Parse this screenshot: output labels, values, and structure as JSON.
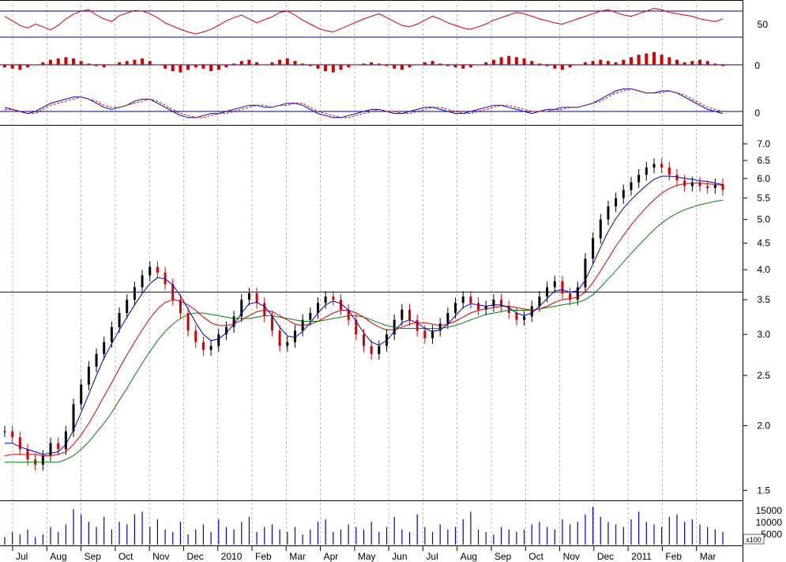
{
  "chart_data": [
    {
      "type": "line",
      "indicator_panel": "RSI",
      "y_ticks": [
        "50"
      ],
      "levels": [
        70,
        30
      ],
      "series": [
        {
          "color": "#d40000",
          "values": [
            62,
            55,
            48,
            44,
            50,
            46,
            41,
            48,
            58,
            65,
            70,
            72,
            64,
            58,
            54,
            63,
            67,
            71,
            70,
            66,
            60,
            52,
            47,
            42,
            38,
            35,
            38,
            42,
            48,
            55,
            60,
            64,
            58,
            52,
            57,
            61,
            68,
            70,
            64,
            56,
            50,
            44,
            40,
            38,
            43,
            48,
            53,
            58,
            62,
            66,
            60,
            54,
            48,
            46,
            50,
            56,
            62,
            58,
            52,
            48,
            44,
            42,
            46,
            50,
            56,
            60,
            64,
            68,
            66,
            62,
            58,
            55,
            52,
            50,
            54,
            58,
            62,
            66,
            70,
            72,
            68,
            64,
            62,
            66,
            70,
            74,
            72,
            68,
            66,
            64,
            62,
            58,
            56,
            54,
            58
          ]
        }
      ]
    },
    {
      "type": "bar",
      "indicator_panel": "MACD histogram",
      "y_ticks": [
        "0"
      ],
      "series": [
        {
          "color": "#d40000",
          "values": [
            -2,
            -3,
            -4,
            -2,
            0,
            2,
            4,
            5,
            6,
            5,
            3,
            1,
            -1,
            -2,
            0,
            2,
            3,
            4,
            5,
            3,
            0,
            -3,
            -5,
            -6,
            -4,
            -2,
            -3,
            -5,
            -4,
            -2,
            1,
            3,
            4,
            2,
            0,
            2,
            4,
            5,
            3,
            1,
            -1,
            -3,
            -5,
            -6,
            -4,
            -2,
            0,
            1,
            2,
            1,
            -1,
            -3,
            -4,
            -2,
            0,
            2,
            3,
            1,
            -1,
            -2,
            -3,
            -2,
            0,
            2,
            4,
            6,
            7,
            6,
            5,
            3,
            1,
            -1,
            -3,
            -4,
            -2,
            0,
            2,
            3,
            4,
            3,
            2,
            4,
            6,
            8,
            9,
            10,
            8,
            6,
            4,
            2,
            3,
            4,
            3,
            1,
            -1
          ]
        }
      ]
    },
    {
      "type": "line",
      "indicator_panel": "MACD",
      "y_ticks": [
        "0"
      ],
      "series": [
        {
          "color": "#0000cc",
          "values": [
            2,
            1,
            0,
            -1,
            0,
            2,
            4,
            5,
            6,
            7,
            7,
            6,
            4,
            2,
            1,
            2,
            3,
            5,
            6,
            6,
            4,
            2,
            0,
            -2,
            -3,
            -3,
            -2,
            -1,
            -1,
            0,
            1,
            2,
            3,
            3,
            2,
            2,
            3,
            4,
            4,
            3,
            1,
            -1,
            -2,
            -3,
            -3,
            -2,
            -1,
            0,
            1,
            1,
            0,
            -1,
            -1,
            0,
            1,
            2,
            2,
            1,
            0,
            -1,
            -1,
            0,
            1,
            2,
            3,
            3,
            2,
            1,
            0,
            -1,
            0,
            1,
            1,
            2,
            2,
            2,
            3,
            4,
            6,
            8,
            10,
            11,
            11,
            10,
            9,
            9,
            10,
            10,
            9,
            7,
            5,
            3,
            1,
            0,
            -1
          ]
        },
        {
          "color": "#d40000",
          "values": [
            1,
            1,
            0,
            -1,
            -1,
            1,
            3,
            4,
            5,
            6,
            7,
            6,
            5,
            3,
            2,
            2,
            3,
            4,
            5,
            6,
            5,
            3,
            1,
            -1,
            -2,
            -3,
            -3,
            -2,
            -1,
            -1,
            0,
            1,
            2,
            3,
            3,
            2,
            3,
            3,
            4,
            4,
            2,
            0,
            -1,
            -2,
            -3,
            -3,
            -2,
            -1,
            0,
            1,
            0,
            0,
            -1,
            -1,
            0,
            1,
            2,
            2,
            1,
            0,
            -1,
            -1,
            0,
            1,
            2,
            3,
            3,
            2,
            1,
            0,
            0,
            0,
            1,
            1,
            2,
            2,
            3,
            4,
            5,
            7,
            9,
            10,
            11,
            10,
            9,
            9,
            9,
            10,
            9,
            8,
            6,
            4,
            2,
            1,
            0
          ]
        }
      ]
    },
    {
      "type": "candlestick",
      "scale": "log",
      "ylim": [
        1.45,
        7.3
      ],
      "y_ticks": [
        "7.0",
        "6.5",
        "6.0",
        "5.5",
        "5.0",
        "4.5",
        "4.0",
        "3.5",
        "3.0",
        "2.5",
        "2.0",
        "1.5"
      ],
      "months": [
        "Jul",
        "Aug",
        "Sep",
        "Oct",
        "Nov",
        "Dec",
        "2010",
        "Feb",
        "Mar",
        "Apr",
        "May",
        "Jun",
        "Jul",
        "Aug",
        "Sep",
        "Oct",
        "Nov",
        "Dec",
        "2011",
        "Feb",
        "Mar"
      ],
      "horizontal_line": 3.62,
      "close": [
        1.95,
        1.9,
        1.8,
        1.72,
        1.68,
        1.75,
        1.85,
        1.8,
        1.95,
        2.2,
        2.4,
        2.6,
        2.75,
        2.9,
        3.1,
        3.3,
        3.5,
        3.7,
        3.9,
        4.05,
        3.95,
        3.75,
        3.5,
        3.3,
        3.05,
        2.9,
        2.8,
        2.85,
        3.0,
        3.1,
        3.25,
        3.5,
        3.6,
        3.45,
        3.25,
        3.05,
        2.85,
        2.9,
        3.05,
        3.2,
        3.3,
        3.45,
        3.55,
        3.5,
        3.35,
        3.2,
        3.0,
        2.85,
        2.75,
        2.85,
        3.0,
        3.2,
        3.35,
        3.2,
        3.05,
        2.95,
        3.05,
        3.15,
        3.3,
        3.45,
        3.55,
        3.45,
        3.35,
        3.4,
        3.5,
        3.4,
        3.3,
        3.2,
        3.25,
        3.4,
        3.55,
        3.7,
        3.8,
        3.6,
        3.5,
        3.7,
        4.2,
        4.6,
        5.0,
        5.3,
        5.5,
        5.7,
        5.9,
        6.1,
        6.3,
        6.4,
        6.3,
        6.1,
        5.95,
        5.8,
        5.9,
        5.8,
        5.75,
        5.85,
        5.7
      ],
      "ma_fast": [
        1.85,
        1.85,
        1.82,
        1.8,
        1.78,
        1.76,
        1.77,
        1.78,
        1.84,
        1.96,
        2.12,
        2.3,
        2.5,
        2.7,
        2.88,
        3.06,
        3.24,
        3.42,
        3.6,
        3.76,
        3.86,
        3.84,
        3.74,
        3.56,
        3.36,
        3.16,
        3.0,
        2.92,
        2.94,
        3.02,
        3.14,
        3.3,
        3.44,
        3.46,
        3.4,
        3.26,
        3.1,
        2.98,
        2.96,
        3.04,
        3.16,
        3.3,
        3.42,
        3.48,
        3.44,
        3.34,
        3.18,
        3.02,
        2.9,
        2.86,
        2.92,
        3.04,
        3.16,
        3.2,
        3.16,
        3.08,
        3.04,
        3.06,
        3.14,
        3.26,
        3.38,
        3.44,
        3.42,
        3.4,
        3.42,
        3.42,
        3.38,
        3.3,
        3.26,
        3.3,
        3.4,
        3.52,
        3.64,
        3.66,
        3.62,
        3.64,
        3.82,
        4.1,
        4.42,
        4.74,
        5.02,
        5.26,
        5.46,
        5.64,
        5.82,
        5.98,
        6.06,
        6.06,
        6.04,
        6.0,
        5.98,
        5.94,
        5.92,
        5.88,
        5.84
      ],
      "ma_mid": [
        1.75,
        1.76,
        1.76,
        1.76,
        1.76,
        1.75,
        1.75,
        1.76,
        1.78,
        1.84,
        1.92,
        2.02,
        2.14,
        2.28,
        2.42,
        2.58,
        2.74,
        2.9,
        3.06,
        3.22,
        3.36,
        3.46,
        3.5,
        3.48,
        3.42,
        3.34,
        3.24,
        3.16,
        3.12,
        3.12,
        3.14,
        3.2,
        3.26,
        3.32,
        3.34,
        3.32,
        3.26,
        3.2,
        3.14,
        3.12,
        3.14,
        3.18,
        3.24,
        3.3,
        3.34,
        3.34,
        3.3,
        3.24,
        3.16,
        3.1,
        3.06,
        3.06,
        3.1,
        3.14,
        3.16,
        3.16,
        3.14,
        3.12,
        3.14,
        3.18,
        3.24,
        3.3,
        3.34,
        3.36,
        3.38,
        3.4,
        3.4,
        3.38,
        3.36,
        3.34,
        3.36,
        3.4,
        3.46,
        3.5,
        3.52,
        3.54,
        3.62,
        3.78,
        3.98,
        4.2,
        4.44,
        4.66,
        4.88,
        5.08,
        5.28,
        5.46,
        5.62,
        5.74,
        5.82,
        5.86,
        5.88,
        5.88,
        5.86,
        5.84,
        5.82
      ],
      "ma_slow": [
        1.7,
        1.7,
        1.7,
        1.7,
        1.7,
        1.7,
        1.7,
        1.7,
        1.72,
        1.75,
        1.8,
        1.86,
        1.94,
        2.02,
        2.12,
        2.24,
        2.36,
        2.5,
        2.64,
        2.78,
        2.92,
        3.04,
        3.14,
        3.22,
        3.28,
        3.3,
        3.3,
        3.28,
        3.26,
        3.24,
        3.22,
        3.22,
        3.22,
        3.24,
        3.26,
        3.26,
        3.24,
        3.22,
        3.2,
        3.18,
        3.18,
        3.18,
        3.2,
        3.22,
        3.24,
        3.26,
        3.26,
        3.24,
        3.2,
        3.16,
        3.12,
        3.1,
        3.08,
        3.08,
        3.08,
        3.08,
        3.08,
        3.08,
        3.1,
        3.12,
        3.16,
        3.2,
        3.24,
        3.28,
        3.3,
        3.32,
        3.34,
        3.34,
        3.34,
        3.34,
        3.36,
        3.38,
        3.4,
        3.42,
        3.44,
        3.46,
        3.5,
        3.58,
        3.7,
        3.84,
        3.98,
        4.14,
        4.3,
        4.46,
        4.62,
        4.78,
        4.92,
        5.04,
        5.14,
        5.22,
        5.28,
        5.34,
        5.38,
        5.42,
        5.45
      ]
    },
    {
      "type": "bar",
      "indicator_panel": "Volume",
      "y_ticks": [
        "15000",
        "10000",
        "5000"
      ],
      "y_unit": "x100",
      "series": [
        {
          "color": "#0000cc",
          "values": [
            3,
            5,
            4,
            6,
            3,
            4,
            7,
            5,
            8,
            14,
            12,
            9,
            7,
            11,
            6,
            9,
            8,
            12,
            13,
            7,
            10,
            6,
            5,
            9,
            4,
            6,
            8,
            5,
            10,
            7,
            6,
            9,
            11,
            5,
            7,
            8,
            6,
            5,
            7,
            4,
            6,
            9,
            10,
            5,
            6,
            8,
            7,
            6,
            9,
            5,
            7,
            11,
            6,
            5,
            12,
            7,
            5,
            8,
            6,
            7,
            10,
            13,
            6,
            5,
            4,
            7,
            6,
            5,
            6,
            8,
            9,
            7,
            6,
            10,
            8,
            9,
            12,
            15,
            11,
            9,
            8,
            7,
            10,
            13,
            9,
            8,
            7,
            11,
            12,
            9,
            10,
            8,
            7,
            6,
            5
          ]
        }
      ]
    }
  ]
}
